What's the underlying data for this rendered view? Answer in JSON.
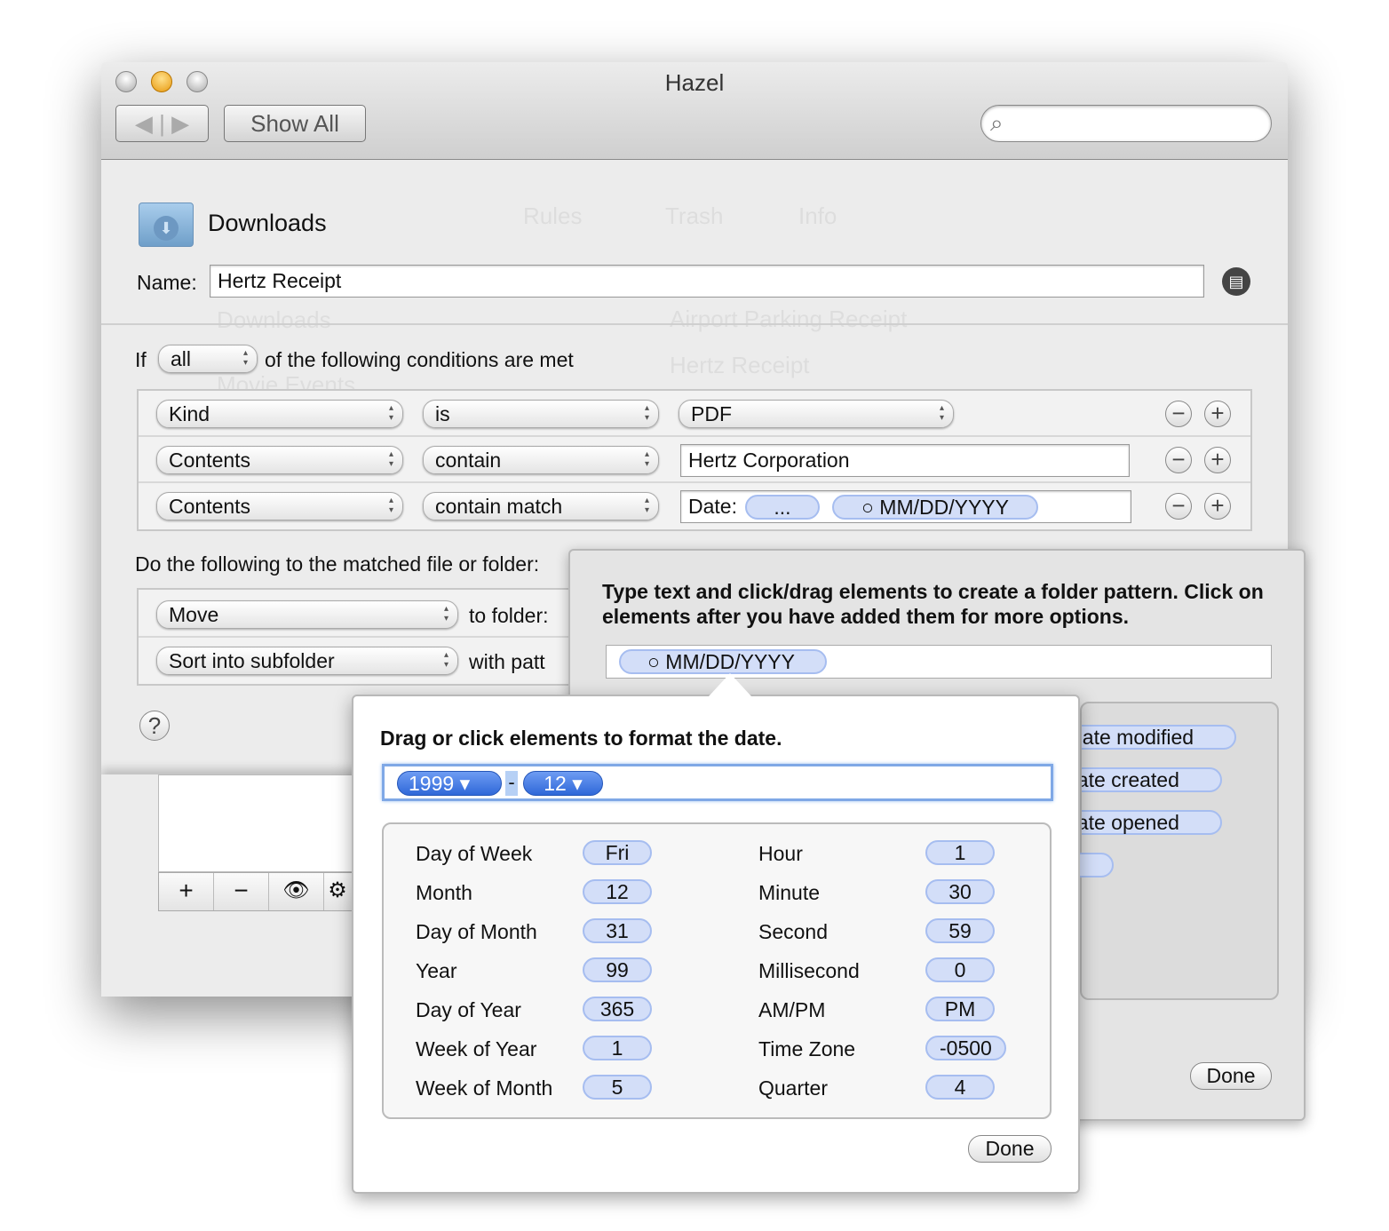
{
  "window": {
    "title": "Hazel",
    "show_all": "Show All",
    "back_icon": "back-arrow-icon",
    "forward_icon": "forward-arrow-icon",
    "search_placeholder": ""
  },
  "ghost": {
    "tabs": [
      "Rules",
      "Trash",
      "Info"
    ],
    "folders": [
      "Downloads",
      "Movie Events"
    ],
    "rules": [
      "Airport Parking Receipt",
      "Hertz Receipt"
    ]
  },
  "folder": {
    "name": "Downloads",
    "icon": "downloads-folder-icon"
  },
  "rule": {
    "name_label": "Name:",
    "name_value": "Hertz Receipt",
    "if_label": "If",
    "match": "all",
    "conditions_label": "of the following conditions are met"
  },
  "conditions": [
    {
      "attribute": "Kind",
      "operator": "is",
      "value": "PDF"
    },
    {
      "attribute": "Contents",
      "operator": "contain",
      "value": "Hertz Corporation"
    },
    {
      "attribute": "Contents",
      "operator": "contain match",
      "value_label": "Date:",
      "tokens": [
        "...",
        "○ MM/DD/YYYY"
      ]
    }
  ],
  "actions_label": "Do the following to the matched file or folder:",
  "actions": [
    {
      "action": "Move",
      "suffix": "to folder:"
    },
    {
      "action": "Sort into subfolder",
      "suffix": "with patt"
    }
  ],
  "list_buttons": [
    "+",
    "−"
  ],
  "pattern_popover": {
    "instructions": "Type text and click/drag elements to create a folder pattern. Click on elements after you have added them for more options.",
    "token": "○ MM/DD/YYYY",
    "elements": [
      "date modified",
      "date created",
      "date opened"
    ],
    "done": "Done"
  },
  "date_popover": {
    "title": "Drag or click elements to format the date.",
    "tokens": [
      "1999",
      "12"
    ],
    "separator": "-",
    "left": [
      [
        "Day of Week",
        "Fri"
      ],
      [
        "Month",
        "12"
      ],
      [
        "Day of Month",
        "31"
      ],
      [
        "Year",
        "99"
      ],
      [
        "Day of Year",
        "365"
      ],
      [
        "Week of Year",
        "1"
      ],
      [
        "Week of Month",
        "5"
      ]
    ],
    "right": [
      [
        "Hour",
        "1"
      ],
      [
        "Minute",
        "30"
      ],
      [
        "Second",
        "59"
      ],
      [
        "Millisecond",
        "0"
      ],
      [
        "AM/PM",
        "PM"
      ],
      [
        "Time Zone",
        "-0500"
      ],
      [
        "Quarter",
        "4"
      ]
    ],
    "done": "Done"
  },
  "colors": {
    "token_fill": "#d3def8",
    "token_selected": "#3a72e0",
    "window_bg": "#ececec"
  }
}
